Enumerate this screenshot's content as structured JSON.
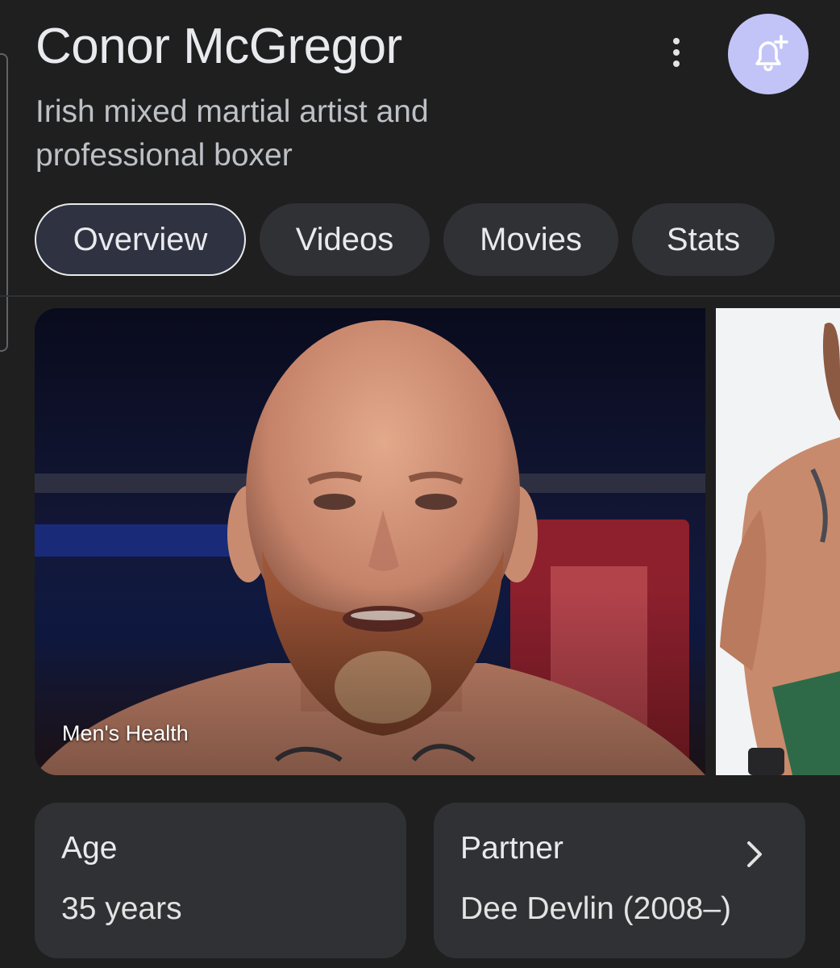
{
  "entity": {
    "title": "Conor McGregor",
    "subtitle": "Irish mixed martial artist and professional boxer"
  },
  "actions": {
    "more_icon": "more-vert-icon",
    "bell_icon": "notification-add-icon",
    "bell_bg_color": "#c2c4f8"
  },
  "tabs": [
    {
      "label": "Overview",
      "selected": true
    },
    {
      "label": "Videos",
      "selected": false
    },
    {
      "label": "Movies",
      "selected": false
    },
    {
      "label": "Stats",
      "selected": false
    }
  ],
  "images": {
    "main_source": "Men's Health"
  },
  "facts": [
    {
      "label": "Age",
      "value": "35 years",
      "has_chevron": false
    },
    {
      "label": "Partner",
      "value": "Dee Devlin (2008–)",
      "has_chevron": true
    }
  ]
}
